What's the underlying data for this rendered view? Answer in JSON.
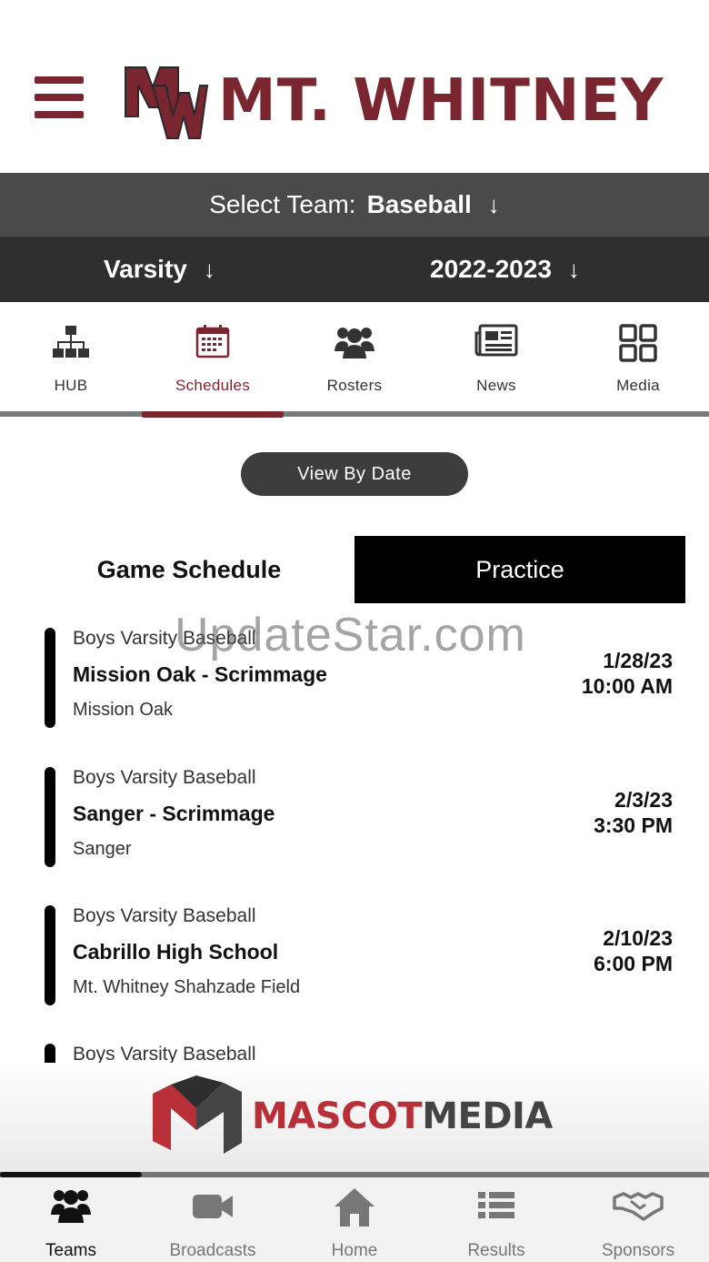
{
  "header": {
    "menu_icon": "hamburger-icon",
    "logo_initials": "MW",
    "logo_text": "MT. WHITNEY",
    "brand_color": "#7a2631"
  },
  "team_select": {
    "label": "Select Team:",
    "value": "Baseball"
  },
  "filters": {
    "level": "Varsity",
    "season": "2022-2023"
  },
  "tabs": [
    {
      "label": "HUB",
      "icon": "hierarchy-icon",
      "active": false
    },
    {
      "label": "Schedules",
      "icon": "calendar-icon",
      "active": true
    },
    {
      "label": "Rosters",
      "icon": "people-icon",
      "active": false
    },
    {
      "label": "News",
      "icon": "newspaper-icon",
      "active": false
    },
    {
      "label": "Media",
      "icon": "grid-icon",
      "active": false
    }
  ],
  "view_button": "View By Date",
  "schedule_toggle": {
    "game": "Game Schedule",
    "practice": "Practice",
    "selected": "practice"
  },
  "events": [
    {
      "team": "Boys Varsity Baseball",
      "title": "Mission Oak - Scrimmage",
      "location": "Mission Oak",
      "date": "1/28/23",
      "time": "10:00 AM"
    },
    {
      "team": "Boys Varsity Baseball",
      "title": "Sanger - Scrimmage",
      "location": "Sanger",
      "date": "2/3/23",
      "time": "3:30 PM"
    },
    {
      "team": "Boys Varsity Baseball",
      "title": "Cabrillo High School",
      "location": "Mt. Whitney Shahzade Field",
      "date": "2/10/23",
      "time": "6:00 PM"
    },
    {
      "team": "Boys Varsity Baseball"
    }
  ],
  "watermark": "UpdateStar.com",
  "sponsor": {
    "name_a": "MASCOT",
    "name_b": "MEDIA",
    "color_a": "#b82f37",
    "color_b": "#444444"
  },
  "bottom_nav": [
    {
      "label": "Teams",
      "icon": "team-icon",
      "active": true
    },
    {
      "label": "Broadcasts",
      "icon": "video-camera-icon",
      "active": false
    },
    {
      "label": "Home",
      "icon": "home-icon",
      "active": false
    },
    {
      "label": "Results",
      "icon": "list-icon",
      "active": false
    },
    {
      "label": "Sponsors",
      "icon": "handshake-icon",
      "active": false
    }
  ]
}
